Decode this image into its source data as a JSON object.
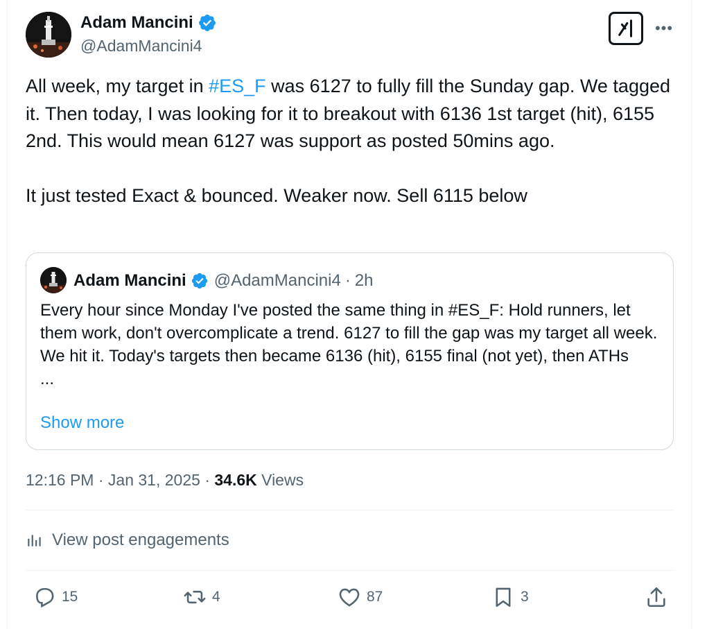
{
  "author": {
    "name": "Adam Mancini",
    "handle": "@AdamMancini4",
    "verified": true
  },
  "header_actions": {
    "grok_label": "Grok",
    "more_label": "More"
  },
  "post": {
    "paragraph_1_pre": "All week, my target in ",
    "paragraph_1_hashtag": "#ES_F",
    "paragraph_1_post": " was 6127 to fully fill the Sunday gap. We tagged it. Then today, I was looking for it to breakout with 6136 1st target (hit), 6155 2nd. This would mean 6127 was support as posted 50mins ago.",
    "paragraph_2": "It just tested Exact & bounced. Weaker now. Sell 6115 below"
  },
  "quote": {
    "name": "Adam Mancini",
    "handle": "@AdamMancini4",
    "separator": "·",
    "time": "2h",
    "body": "Every hour since Monday I've posted the same thing in #ES_F: Hold runners, let them work, don't overcomplicate a trend. 6127 to fill the gap was my target all week. We hit it. Today's targets then became 6136 (hit), 6155 final (not yet), then ATHs",
    "ellipsis": "...",
    "show_more": "Show more"
  },
  "meta": {
    "time": "12:16 PM",
    "separator": "·",
    "date": "Jan 31, 2025",
    "separator2": "·",
    "views_count": "34.6K",
    "views_label": "Views"
  },
  "engagements": {
    "label": "View post engagements"
  },
  "actions": {
    "replies": "15",
    "reposts": "4",
    "likes": "87",
    "bookmarks": "3"
  },
  "colors": {
    "accent": "#1d9bf0",
    "text": "#0f1419",
    "secondary": "#536471",
    "border": "#cfd9de"
  }
}
